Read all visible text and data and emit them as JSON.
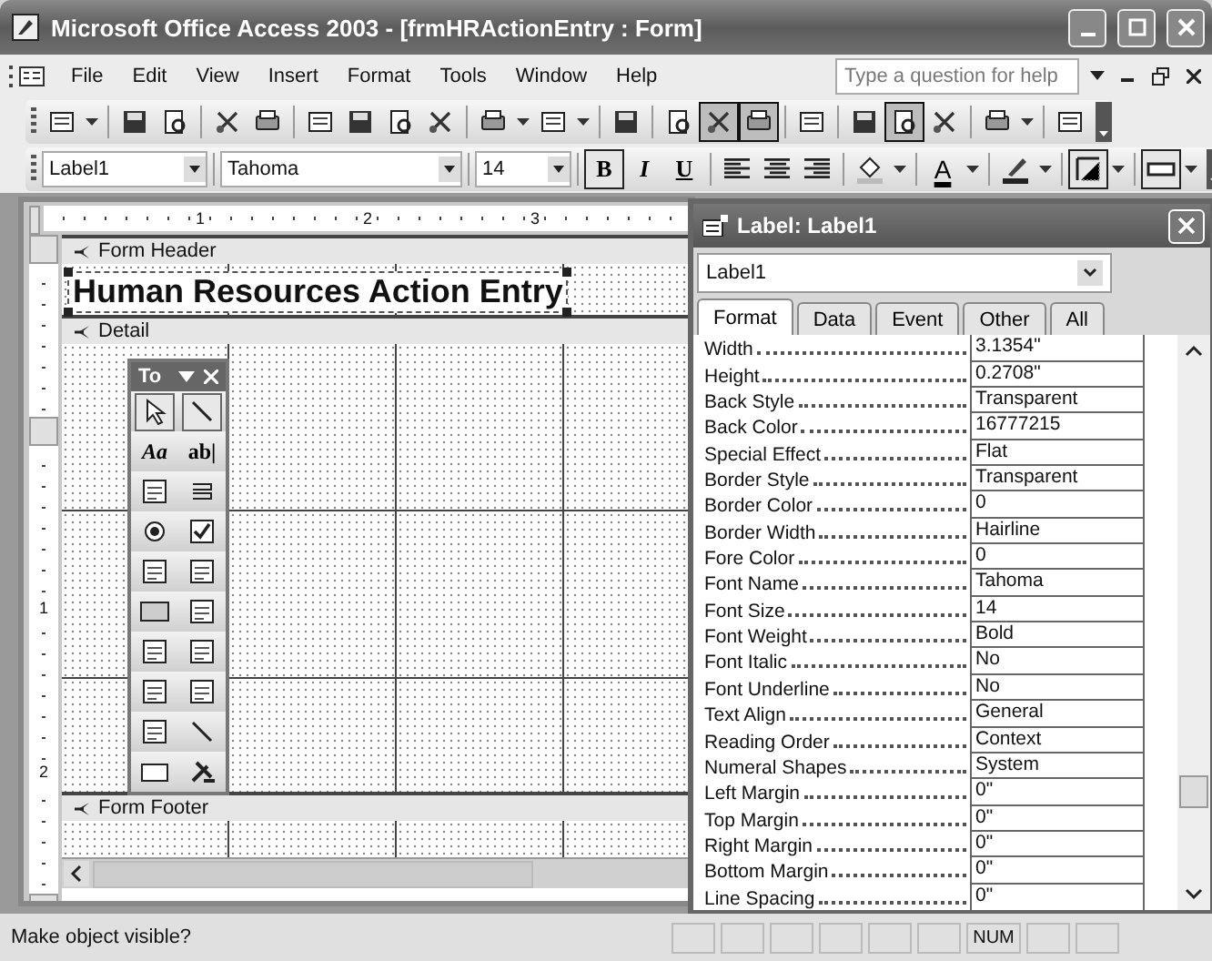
{
  "window": {
    "title": "Microsoft Office Access 2003 - [frmHRActionEntry : Form]"
  },
  "menu": [
    "File",
    "Edit",
    "View",
    "Insert",
    "Format",
    "Tools",
    "Window",
    "Help"
  ],
  "help_box": {
    "placeholder": "Type a question for help"
  },
  "toolbar_main": [
    {
      "pressed": false
    },
    {
      "pressed": false
    },
    {
      "pressed": false
    },
    {
      "pressed": false
    },
    {
      "pressed": false
    },
    {
      "pressed": false
    },
    {
      "pressed": false
    },
    {
      "pressed": false
    },
    {
      "pressed": false
    },
    {
      "pressed": false
    },
    {
      "pressed": false
    },
    {
      "pressed": false
    },
    {
      "pressed": false
    },
    {
      "pressed": true
    },
    {
      "pressed": true
    },
    {
      "pressed": false
    },
    {
      "pressed": false
    },
    {
      "pressed": true
    },
    {
      "pressed": false
    },
    {
      "pressed": false
    },
    {
      "pressed": false
    }
  ],
  "format_bar": {
    "object": "Label1",
    "font": "Tahoma",
    "size": "14",
    "style_buttons": [
      {
        "label": "B",
        "pressed": true
      },
      {
        "label": "I",
        "pressed": false
      },
      {
        "label": "U",
        "pressed": false
      }
    ],
    "font_color_label": "A"
  },
  "ruler": {
    "top_numbers": [
      "1",
      "2",
      "3"
    ],
    "side_numbers": [
      "1",
      "2"
    ]
  },
  "form": {
    "sections": [
      {
        "kind": "header",
        "title": "Form Header"
      },
      {
        "kind": "detail",
        "title": "Detail"
      },
      {
        "kind": "footer",
        "title": "Form Footer"
      }
    ],
    "heading_label": "Human Resources Action Entry"
  },
  "toolbox": {
    "title": "To",
    "text_tools": [
      "Aa",
      "ab|"
    ]
  },
  "property_sheet": {
    "title": "Label: Label1",
    "object": "Label1",
    "tabs": [
      {
        "label": "Format",
        "selected": true
      },
      {
        "label": "Data",
        "selected": false
      },
      {
        "label": "Event",
        "selected": false
      },
      {
        "label": "Other",
        "selected": false
      },
      {
        "label": "All",
        "selected": false
      }
    ],
    "rows": [
      {
        "name": "Width",
        "value": "3.1354\""
      },
      {
        "name": "Height",
        "value": "0.2708\""
      },
      {
        "name": "Back Style",
        "value": "Transparent"
      },
      {
        "name": "Back Color",
        "value": "16777215"
      },
      {
        "name": "Special Effect",
        "value": "Flat"
      },
      {
        "name": "Border Style",
        "value": "Transparent"
      },
      {
        "name": "Border Color",
        "value": "0"
      },
      {
        "name": "Border Width",
        "value": "Hairline"
      },
      {
        "name": "Fore Color",
        "value": "0"
      },
      {
        "name": "Font Name",
        "value": "Tahoma"
      },
      {
        "name": "Font Size",
        "value": "14"
      },
      {
        "name": "Font Weight",
        "value": "Bold"
      },
      {
        "name": "Font Italic",
        "value": "No"
      },
      {
        "name": "Font Underline",
        "value": "No"
      },
      {
        "name": "Text Align",
        "value": "General"
      },
      {
        "name": "Reading Order",
        "value": "Context"
      },
      {
        "name": "Numeral Shapes",
        "value": "System"
      },
      {
        "name": "Left Margin",
        "value": "0\""
      },
      {
        "name": "Top Margin",
        "value": "0\""
      },
      {
        "name": "Right Margin",
        "value": "0\""
      },
      {
        "name": "Bottom Margin",
        "value": "0\""
      },
      {
        "name": "Line Spacing",
        "value": "0\""
      }
    ]
  },
  "status_bar": {
    "message": "Make object visible?",
    "indicator": "NUM"
  }
}
